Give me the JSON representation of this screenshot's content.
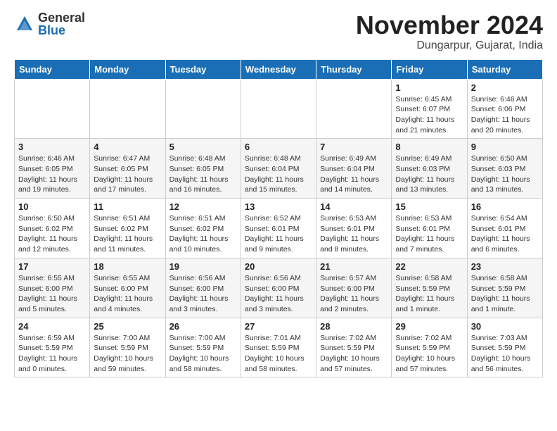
{
  "logo": {
    "general": "General",
    "blue": "Blue"
  },
  "header": {
    "month": "November 2024",
    "location": "Dungarpur, Gujarat, India"
  },
  "weekdays": [
    "Sunday",
    "Monday",
    "Tuesday",
    "Wednesday",
    "Thursday",
    "Friday",
    "Saturday"
  ],
  "weeks": [
    [
      {
        "day": "",
        "info": ""
      },
      {
        "day": "",
        "info": ""
      },
      {
        "day": "",
        "info": ""
      },
      {
        "day": "",
        "info": ""
      },
      {
        "day": "",
        "info": ""
      },
      {
        "day": "1",
        "info": "Sunrise: 6:45 AM\nSunset: 6:07 PM\nDaylight: 11 hours and 21 minutes."
      },
      {
        "day": "2",
        "info": "Sunrise: 6:46 AM\nSunset: 6:06 PM\nDaylight: 11 hours and 20 minutes."
      }
    ],
    [
      {
        "day": "3",
        "info": "Sunrise: 6:46 AM\nSunset: 6:05 PM\nDaylight: 11 hours and 19 minutes."
      },
      {
        "day": "4",
        "info": "Sunrise: 6:47 AM\nSunset: 6:05 PM\nDaylight: 11 hours and 17 minutes."
      },
      {
        "day": "5",
        "info": "Sunrise: 6:48 AM\nSunset: 6:05 PM\nDaylight: 11 hours and 16 minutes."
      },
      {
        "day": "6",
        "info": "Sunrise: 6:48 AM\nSunset: 6:04 PM\nDaylight: 11 hours and 15 minutes."
      },
      {
        "day": "7",
        "info": "Sunrise: 6:49 AM\nSunset: 6:04 PM\nDaylight: 11 hours and 14 minutes."
      },
      {
        "day": "8",
        "info": "Sunrise: 6:49 AM\nSunset: 6:03 PM\nDaylight: 11 hours and 13 minutes."
      },
      {
        "day": "9",
        "info": "Sunrise: 6:50 AM\nSunset: 6:03 PM\nDaylight: 11 hours and 13 minutes."
      }
    ],
    [
      {
        "day": "10",
        "info": "Sunrise: 6:50 AM\nSunset: 6:02 PM\nDaylight: 11 hours and 12 minutes."
      },
      {
        "day": "11",
        "info": "Sunrise: 6:51 AM\nSunset: 6:02 PM\nDaylight: 11 hours and 11 minutes."
      },
      {
        "day": "12",
        "info": "Sunrise: 6:51 AM\nSunset: 6:02 PM\nDaylight: 11 hours and 10 minutes."
      },
      {
        "day": "13",
        "info": "Sunrise: 6:52 AM\nSunset: 6:01 PM\nDaylight: 11 hours and 9 minutes."
      },
      {
        "day": "14",
        "info": "Sunrise: 6:53 AM\nSunset: 6:01 PM\nDaylight: 11 hours and 8 minutes."
      },
      {
        "day": "15",
        "info": "Sunrise: 6:53 AM\nSunset: 6:01 PM\nDaylight: 11 hours and 7 minutes."
      },
      {
        "day": "16",
        "info": "Sunrise: 6:54 AM\nSunset: 6:01 PM\nDaylight: 11 hours and 6 minutes."
      }
    ],
    [
      {
        "day": "17",
        "info": "Sunrise: 6:55 AM\nSunset: 6:00 PM\nDaylight: 11 hours and 5 minutes."
      },
      {
        "day": "18",
        "info": "Sunrise: 6:55 AM\nSunset: 6:00 PM\nDaylight: 11 hours and 4 minutes."
      },
      {
        "day": "19",
        "info": "Sunrise: 6:56 AM\nSunset: 6:00 PM\nDaylight: 11 hours and 3 minutes."
      },
      {
        "day": "20",
        "info": "Sunrise: 6:56 AM\nSunset: 6:00 PM\nDaylight: 11 hours and 3 minutes."
      },
      {
        "day": "21",
        "info": "Sunrise: 6:57 AM\nSunset: 6:00 PM\nDaylight: 11 hours and 2 minutes."
      },
      {
        "day": "22",
        "info": "Sunrise: 6:58 AM\nSunset: 5:59 PM\nDaylight: 11 hours and 1 minute."
      },
      {
        "day": "23",
        "info": "Sunrise: 6:58 AM\nSunset: 5:59 PM\nDaylight: 11 hours and 1 minute."
      }
    ],
    [
      {
        "day": "24",
        "info": "Sunrise: 6:59 AM\nSunset: 5:59 PM\nDaylight: 11 hours and 0 minutes."
      },
      {
        "day": "25",
        "info": "Sunrise: 7:00 AM\nSunset: 5:59 PM\nDaylight: 10 hours and 59 minutes."
      },
      {
        "day": "26",
        "info": "Sunrise: 7:00 AM\nSunset: 5:59 PM\nDaylight: 10 hours and 58 minutes."
      },
      {
        "day": "27",
        "info": "Sunrise: 7:01 AM\nSunset: 5:59 PM\nDaylight: 10 hours and 58 minutes."
      },
      {
        "day": "28",
        "info": "Sunrise: 7:02 AM\nSunset: 5:59 PM\nDaylight: 10 hours and 57 minutes."
      },
      {
        "day": "29",
        "info": "Sunrise: 7:02 AM\nSunset: 5:59 PM\nDaylight: 10 hours and 57 minutes."
      },
      {
        "day": "30",
        "info": "Sunrise: 7:03 AM\nSunset: 5:59 PM\nDaylight: 10 hours and 56 minutes."
      }
    ]
  ]
}
